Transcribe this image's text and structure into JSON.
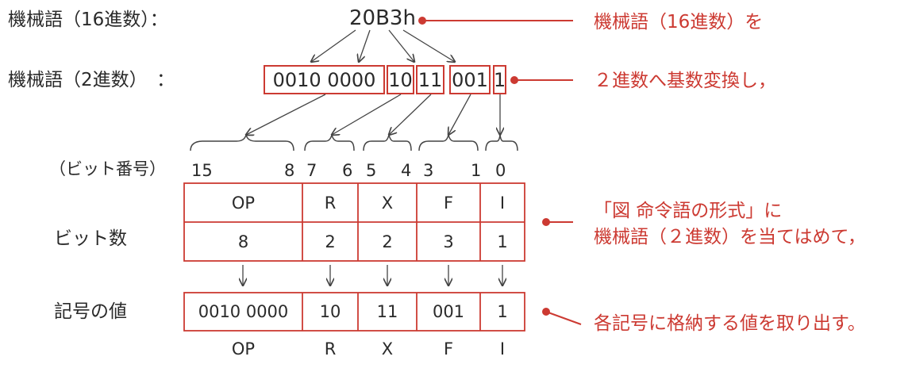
{
  "labels": {
    "hex_label": "機械語（16進数）：",
    "bin_label": "機械語（2進数）　：",
    "bitnum_label": "（ビット番号）",
    "bitcount_label": "ビット数",
    "value_label": "記号の値"
  },
  "hex_value": "20B3h",
  "binary_groups": [
    "0010 0000",
    "10",
    "11",
    "001",
    "1"
  ],
  "bit_numbers": [
    "15",
    "8",
    "7",
    "6",
    "5",
    "4",
    "3",
    "1",
    "0"
  ],
  "format_table": {
    "fields": [
      "OP",
      "R",
      "X",
      "F",
      "I"
    ],
    "bit_counts": [
      "8",
      "2",
      "2",
      "3",
      "1"
    ],
    "values": [
      "0010 0000",
      "10",
      "11",
      "001",
      "1"
    ],
    "bottom_labels": [
      "OP",
      "R",
      "X",
      "F",
      "I"
    ]
  },
  "notes": {
    "note1": "機械語（16進数）を",
    "note2": "２進数へ基数変換し，",
    "note3_line1": "「図 命令語の形式」に",
    "note3_line2": "機械語（２進数）を当てはめて，",
    "note4": "各記号に格納する値を取り出す。"
  },
  "colors": {
    "accent": "#cc3a32",
    "text": "#2a2a2a"
  }
}
